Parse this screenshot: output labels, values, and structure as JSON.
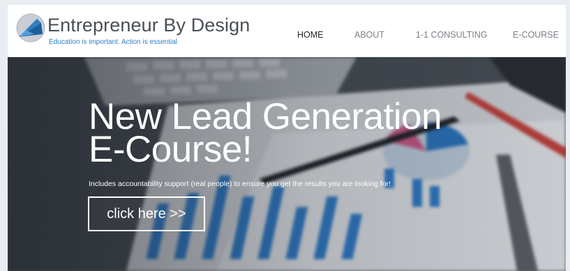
{
  "brand": {
    "title": "Entrepreneur By Design",
    "tagline": "Education is important. Action is essential",
    "accent_color": "#2d7fc3"
  },
  "nav": {
    "items": [
      {
        "label": "HOME",
        "active": true
      },
      {
        "label": "ABOUT",
        "active": false
      },
      {
        "label": "1-1 CONSULTING",
        "active": false
      },
      {
        "label": "E-COURSE",
        "active": false
      }
    ]
  },
  "hero": {
    "title_line1": "New Lead Generation",
    "title_line2": "E-Course!",
    "subtitle": "Includes accountability support (real people) to ensure you get the results you are looking for!",
    "cta_label": "click here >>",
    "background_icon": "laptop-and-charts-photo"
  }
}
